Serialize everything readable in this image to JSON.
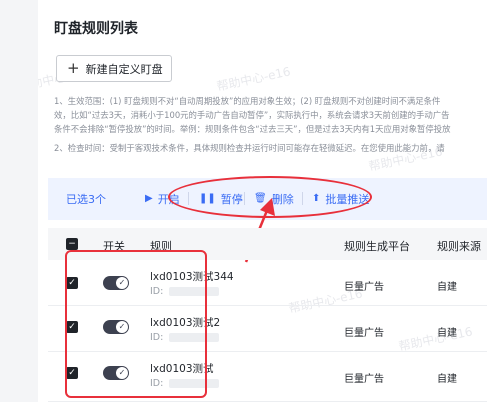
{
  "page": {
    "title": "盯盘规则列表",
    "add_button_label": "新建自定义盯盘",
    "description_lines": [
      "1、生效范围：(1) 盯盘规则不对“自动周期投放”的应用对象生效；(2) 盯盘规则不对创建时间不满足条件",
      "效，比如“过去3天，消耗小于100元的手动广告自动暂停”，实际执行中，系统会请求3天前创建的手动广告",
      "条件不会排除“暂停投放”的时间。举例：规则条件包含“过去三天”，但是过去3天内有1天应用对象暂停投放",
      "2、检查时间：受制于客观技术条件，具体规则检查并运行时间可能存在轻微延迟。在您使用此能力前，请"
    ]
  },
  "action_bar": {
    "selected_label": "已选3个",
    "start_label": "开启",
    "pause_label": "暂停",
    "delete_label": "删除",
    "push_label": "批量推送"
  },
  "table": {
    "headers": [
      "开关",
      "规则",
      "规则生成平台",
      "规则来源"
    ],
    "rows": [
      {
        "name": "lxd0103测试344",
        "id_label": "ID:",
        "platform": "巨量广告",
        "source": "自建",
        "checked": true,
        "enabled": true
      },
      {
        "name": "lxd0103测试2",
        "id_label": "ID:",
        "platform": "巨量广告",
        "source": "自建",
        "checked": true,
        "enabled": true
      },
      {
        "name": "lxd0103测试",
        "id_label": "ID:",
        "platform": "巨量广告",
        "source": "自建",
        "checked": true,
        "enabled": true
      }
    ]
  },
  "watermark": "帮助中心-e16",
  "colors": {
    "accent": "#3a6cf4",
    "annotation": "#e8303b",
    "toggle_on": "#3d4150"
  },
  "icons": {
    "start": "play-icon",
    "pause": "pause-icon",
    "delete": "trash-icon",
    "push": "push-icon",
    "checkbox": "check-icon"
  }
}
